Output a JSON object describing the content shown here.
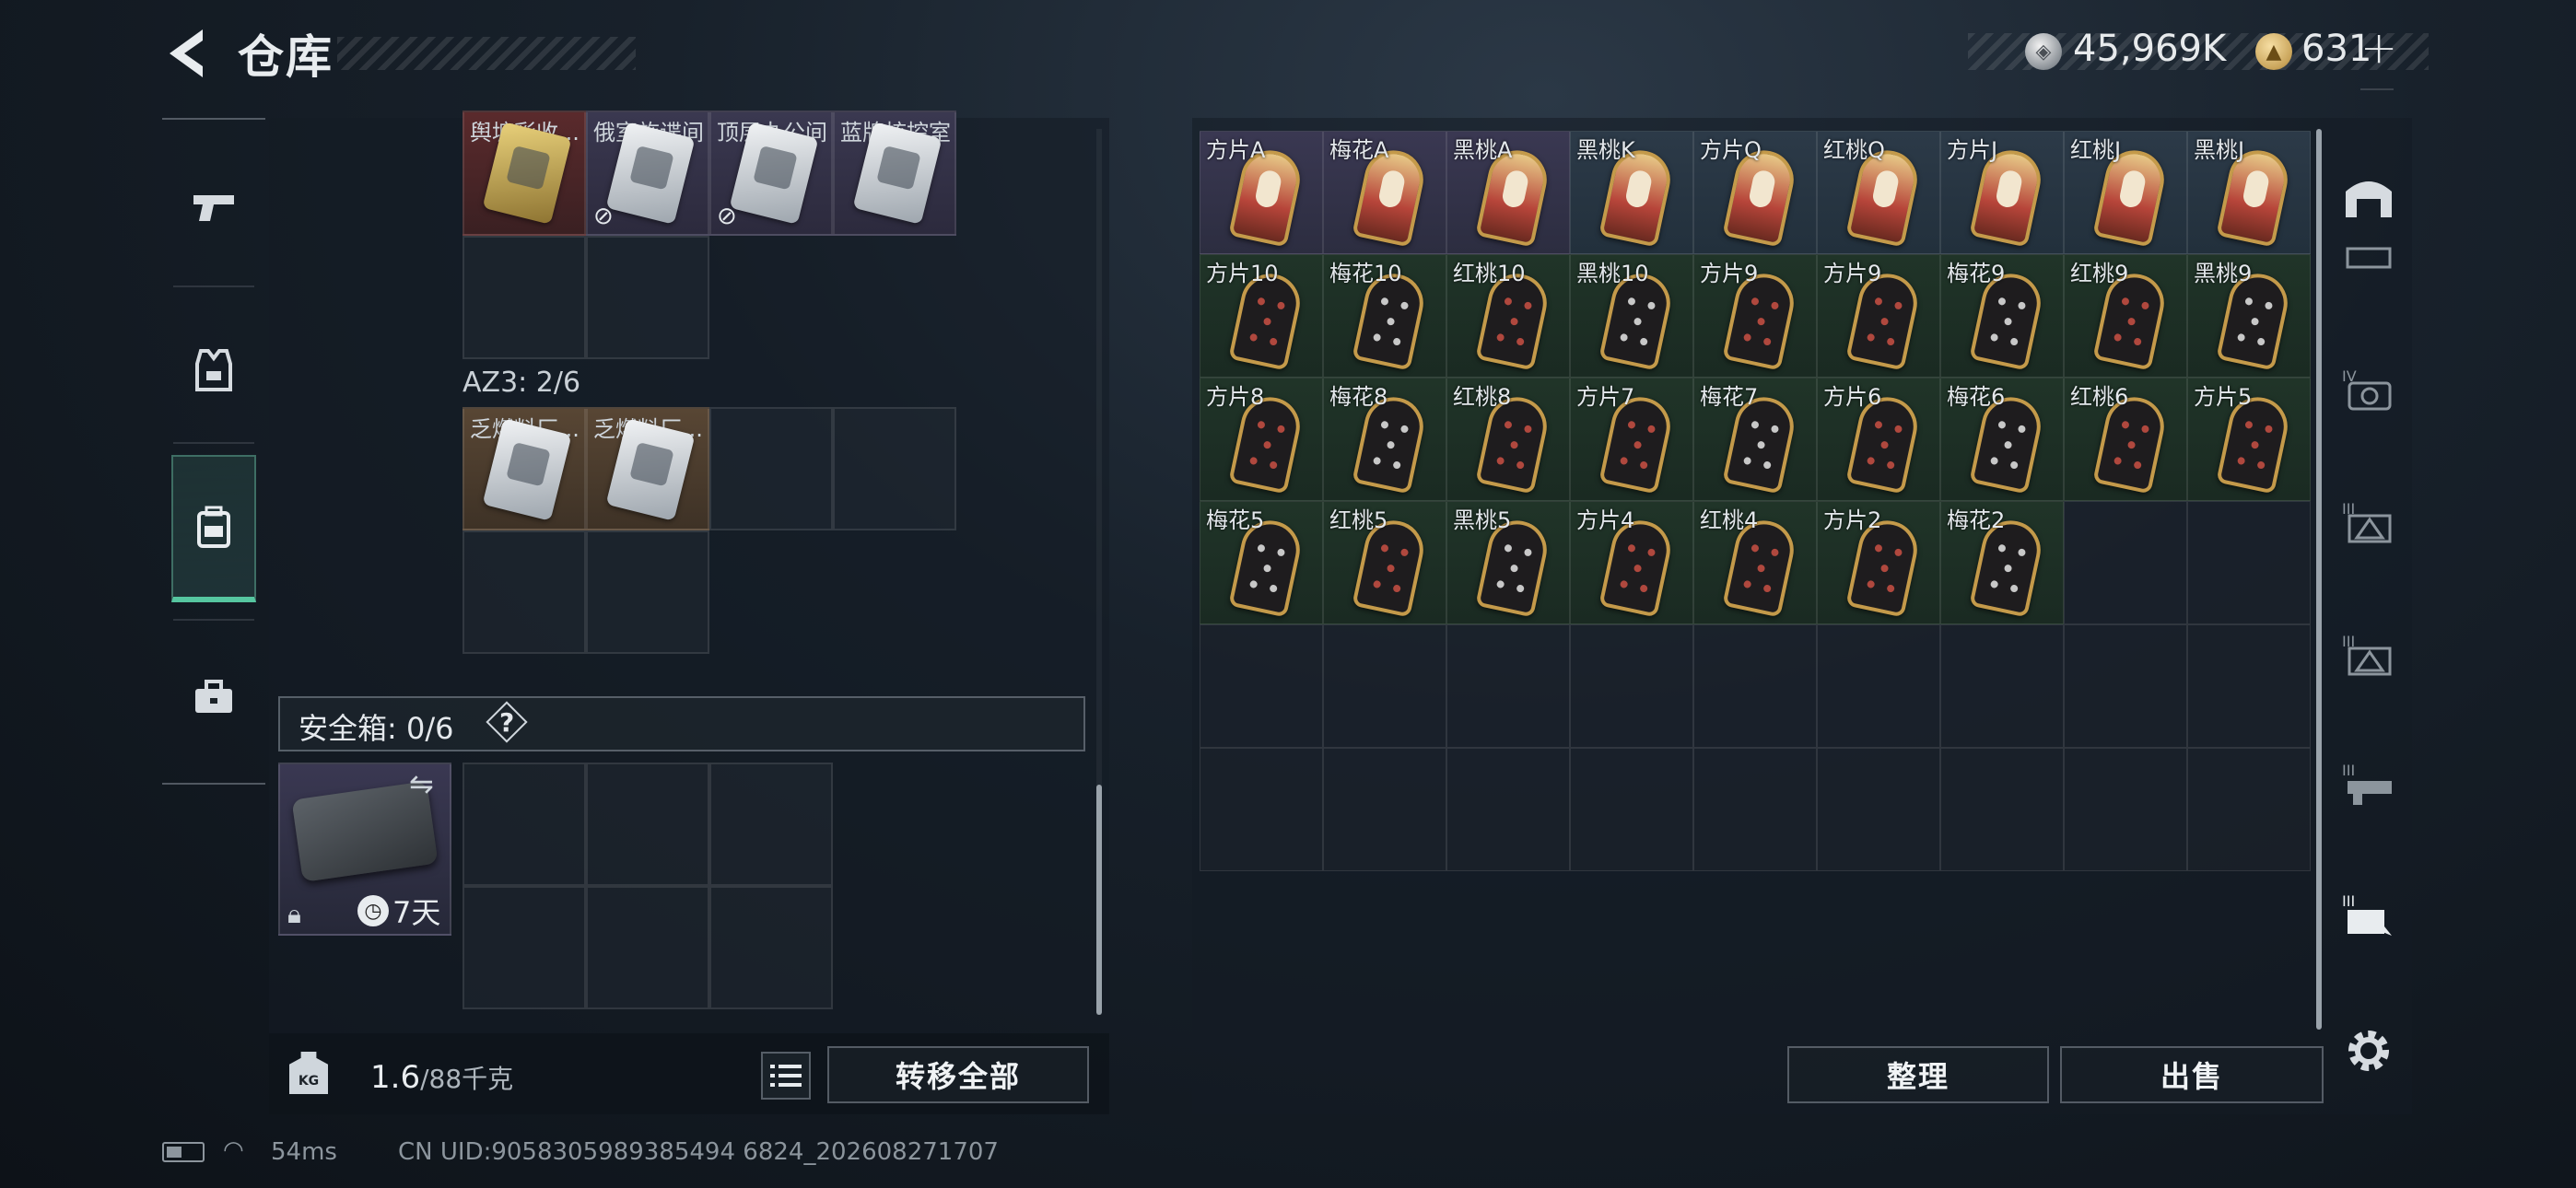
{
  "header": {
    "title": "仓库",
    "currency": [
      {
        "name": "silver",
        "value": "45,969K"
      },
      {
        "name": "gold",
        "value": "631"
      }
    ],
    "plus": "+"
  },
  "left_nav": [
    {
      "icon": "pistol-icon",
      "active": false
    },
    {
      "icon": "armor-vest-icon",
      "active": false
    },
    {
      "icon": "backpack-icon",
      "active": true
    },
    {
      "icon": "toolbox-icon",
      "active": false
    }
  ],
  "left_panel": {
    "top_row_labels": [
      "舆塘彩收...",
      "俄室施谍间",
      "顶层办公间",
      "蓝牌核控室"
    ],
    "az3_label": "AZ3: 2/6",
    "az3_items": [
      "乏燃料厂...",
      "乏燃料厂..."
    ],
    "safebox_label": "安全箱: 0/6",
    "help": "?",
    "case_days": "7天",
    "weight_value": "1.6",
    "weight_total": "/88千克",
    "weight_unit_icon": "KG",
    "transfer_all": "转移全部"
  },
  "right_panel": {
    "cards": [
      [
        "方片A",
        "梅花A",
        "黑桃A",
        "黑桃K",
        "方片Q",
        "红桃Q",
        "方片J",
        "红桃J",
        "黑桃J"
      ],
      [
        "方片10",
        "梅花10",
        "红桃10",
        "黑桃10",
        "方片9",
        "方片9",
        "梅花9",
        "红桃9",
        "黑桃9"
      ],
      [
        "方片8",
        "梅花8",
        "红桃8",
        "方片7",
        "梅花7",
        "方片6",
        "梅花6",
        "红桃6",
        "方片5"
      ],
      [
        "梅花5",
        "红桃5",
        "黑桃5",
        "方片4",
        "红桃4",
        "方片2",
        "梅花2"
      ]
    ],
    "sort_button": "整理",
    "sell_button": "出售"
  },
  "status_bar": {
    "ping": "54ms",
    "uid": "CN UID:9058305989385494 6824_202608271707"
  }
}
